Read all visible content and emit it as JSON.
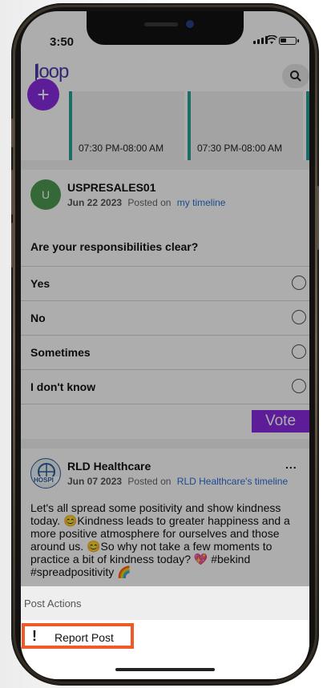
{
  "status_bar": {
    "time": "3:50"
  },
  "app": {
    "logo_text": "loop"
  },
  "events": [
    {
      "time": "07:30 PM-08:00 AM"
    },
    {
      "time": "07:30 PM-08:00 AM"
    }
  ],
  "poll_post": {
    "author_initial": "U",
    "author": "USPRESALES01",
    "date": "Jun 22 2023",
    "posted_on_prefix": "Posted on",
    "posted_on_target": "my timeline",
    "question": "Are your responsibilities clear?",
    "options": [
      "Yes",
      "No",
      "Sometimes",
      "I don't know"
    ],
    "vote_label": "Vote"
  },
  "feed_post": {
    "author": "RLD Healthcare",
    "date": "Jun 07 2023",
    "posted_on_prefix": "Posted on",
    "posted_on_target": "RLD Healthcare's timeline",
    "body": "Let's all spread some positivity and show kindness today. 😊Kindness leads to greater happiness and a more positive atmosphere for ourselves and those around us. 😊So why not take a few moments to practice a bit of kindness today? 💖 #bekind #spreadpositivity 🌈",
    "more": "..."
  },
  "sheet": {
    "title": "Post Actions",
    "items": [
      {
        "icon": "exclamation-icon",
        "label": "Report Post"
      }
    ]
  },
  "colors": {
    "accent": "#8a2be2",
    "highlight": "#ef5a26",
    "link": "#2a6fd6"
  }
}
